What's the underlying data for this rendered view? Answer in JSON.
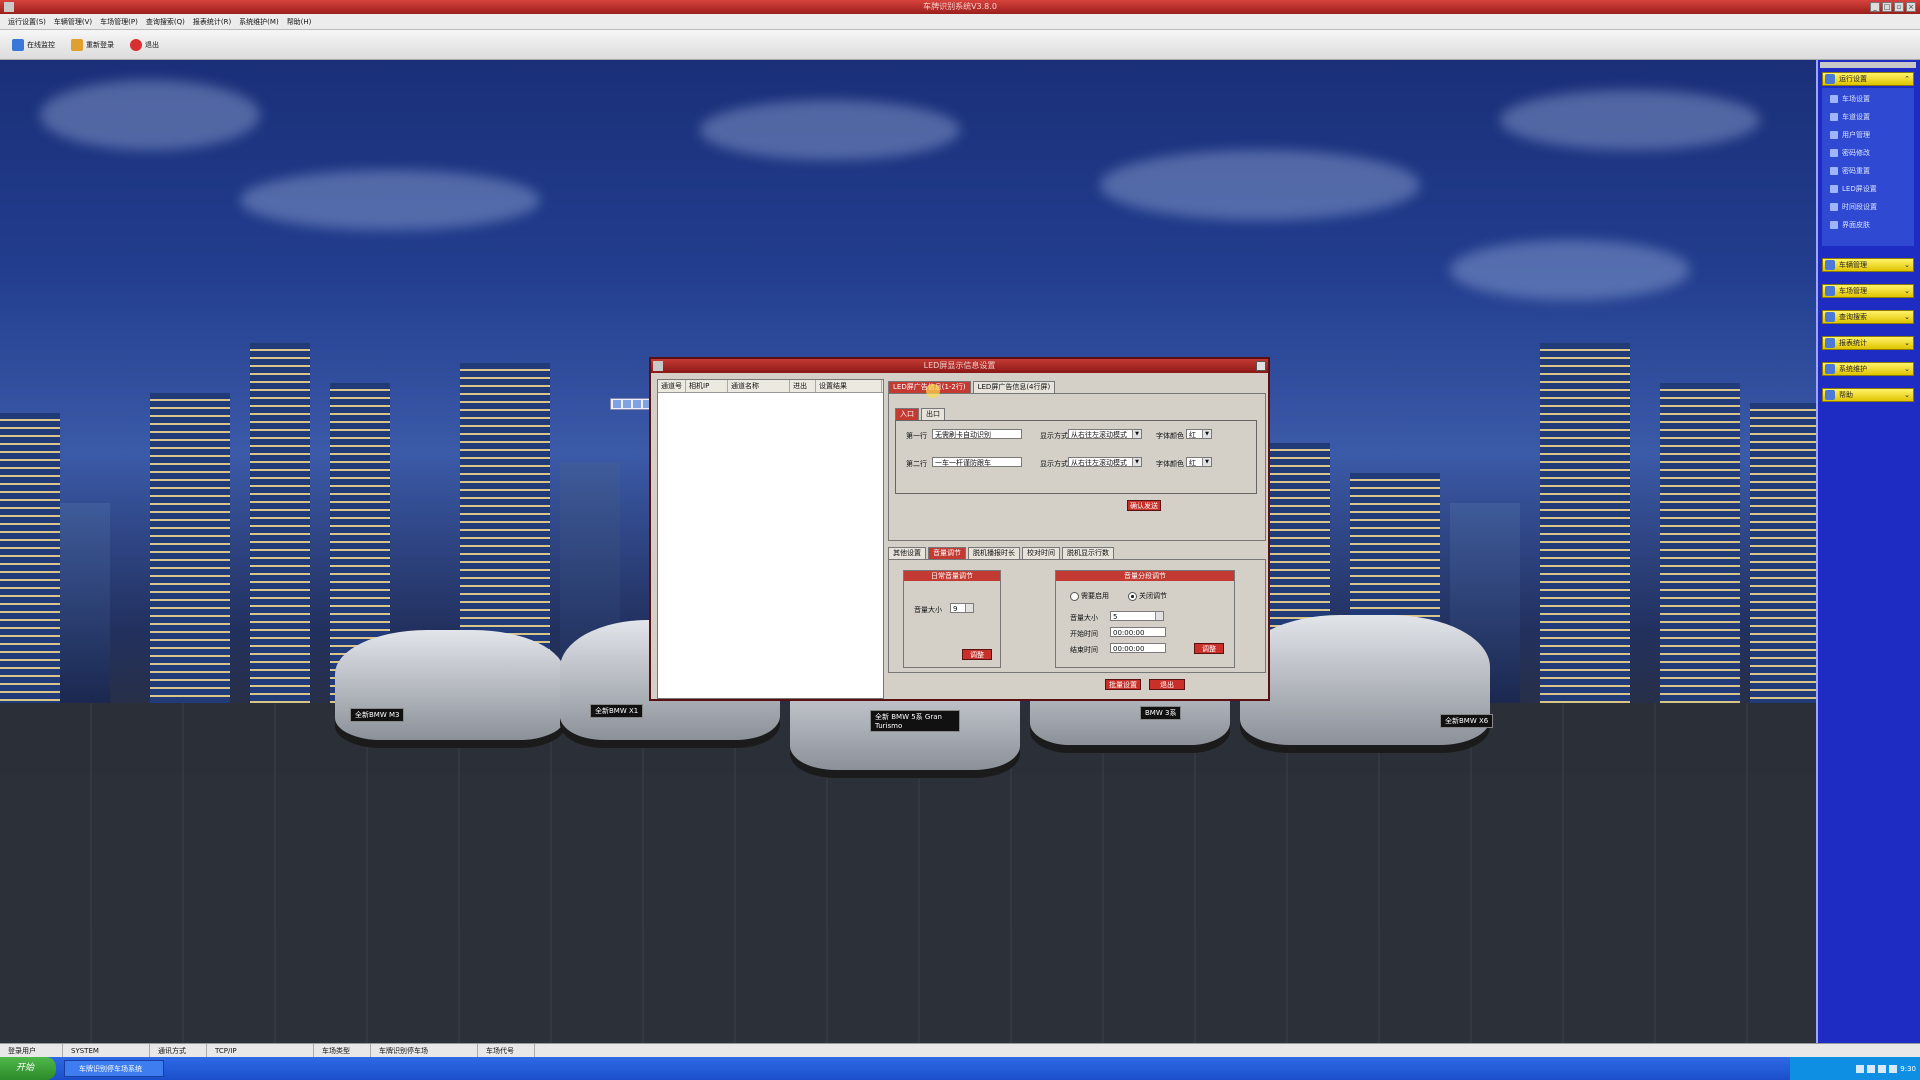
{
  "window": {
    "title": "车牌识别系统V3.8.0"
  },
  "menu": [
    "运行设置(S)",
    "车辆管理(V)",
    "车场管理(P)",
    "查询搜索(Q)",
    "报表统计(R)",
    "系统维护(M)",
    "帮助(H)"
  ],
  "toolbar": [
    {
      "label": "在线监控",
      "icon": "monitor-icon",
      "color": "#3a78d8"
    },
    {
      "label": "重新登录",
      "icon": "login-icon",
      "color": "#e0a030"
    },
    {
      "label": "退出",
      "icon": "exit-icon",
      "color": "#d83030"
    }
  ],
  "sidebar": {
    "groups": [
      {
        "label": "运行设置",
        "items": [
          "车场设置",
          "车道设置",
          "用户管理",
          "密码修改",
          "密码重置",
          "LED屏设置",
          "时间段设置",
          "界面皮肤"
        ]
      },
      {
        "label": "车辆管理"
      },
      {
        "label": "车场管理"
      },
      {
        "label": "查询搜索"
      },
      {
        "label": "报表统计"
      },
      {
        "label": "系统维护"
      },
      {
        "label": "帮助"
      }
    ]
  },
  "scene": {
    "plates": [
      "全新BMW M3",
      "全新BMW X1",
      "全新 BMW 5系 Gran Turismo",
      "BMW 3系",
      "全新BMW X6"
    ]
  },
  "dialog": {
    "title": "LED屏显示信息设置",
    "list_columns": [
      "通道号",
      "相机IP",
      "通道名称",
      "进出",
      "设置结果"
    ],
    "top_tabs": [
      "LED屏广告信息(1-2行)",
      "LED屏广告信息(4行屏)"
    ],
    "sub_tabs": [
      "入口",
      "出口"
    ],
    "rows": [
      {
        "label": "第一行",
        "value": "无需刷卡自动识别",
        "mode_label": "显示方式",
        "mode": "从右往左滚动模式",
        "color_label": "字体颜色",
        "color": "红"
      },
      {
        "label": "第二行",
        "value": "一车一杆谨防跟车",
        "mode_label": "显示方式",
        "mode": "从右往左滚动模式",
        "color_label": "字体颜色",
        "color": "红"
      }
    ],
    "send_button": "确认发送",
    "bottom_tabs": [
      "其他设置",
      "音量调节",
      "脱机播报时长",
      "校对时间",
      "脱机显示行数"
    ],
    "daily_volume": {
      "title": "日常音量调节",
      "size_label": "音量大小",
      "size_value": "9",
      "adjust_button": "调整"
    },
    "timed_volume": {
      "title": "音量分段调节",
      "enable_label": "需要启用",
      "disable_label": "关闭调节",
      "size_label": "音量大小",
      "size_value": "5",
      "start_label": "开始时间",
      "start_value": "00:00:00",
      "end_label": "结束时间",
      "end_value": "00:00:00",
      "adjust_button": "调整"
    },
    "apply_button": "批量设置",
    "exit_button": "退出"
  },
  "statusbar": [
    "登录用户",
    "SYSTEM",
    "通讯方式",
    "TCP/IP",
    "车场类型",
    "车牌识别停车场",
    "车场代号"
  ],
  "taskbar": {
    "start": "开始",
    "task": "车牌识别停车场系统",
    "clock": "9:30"
  }
}
